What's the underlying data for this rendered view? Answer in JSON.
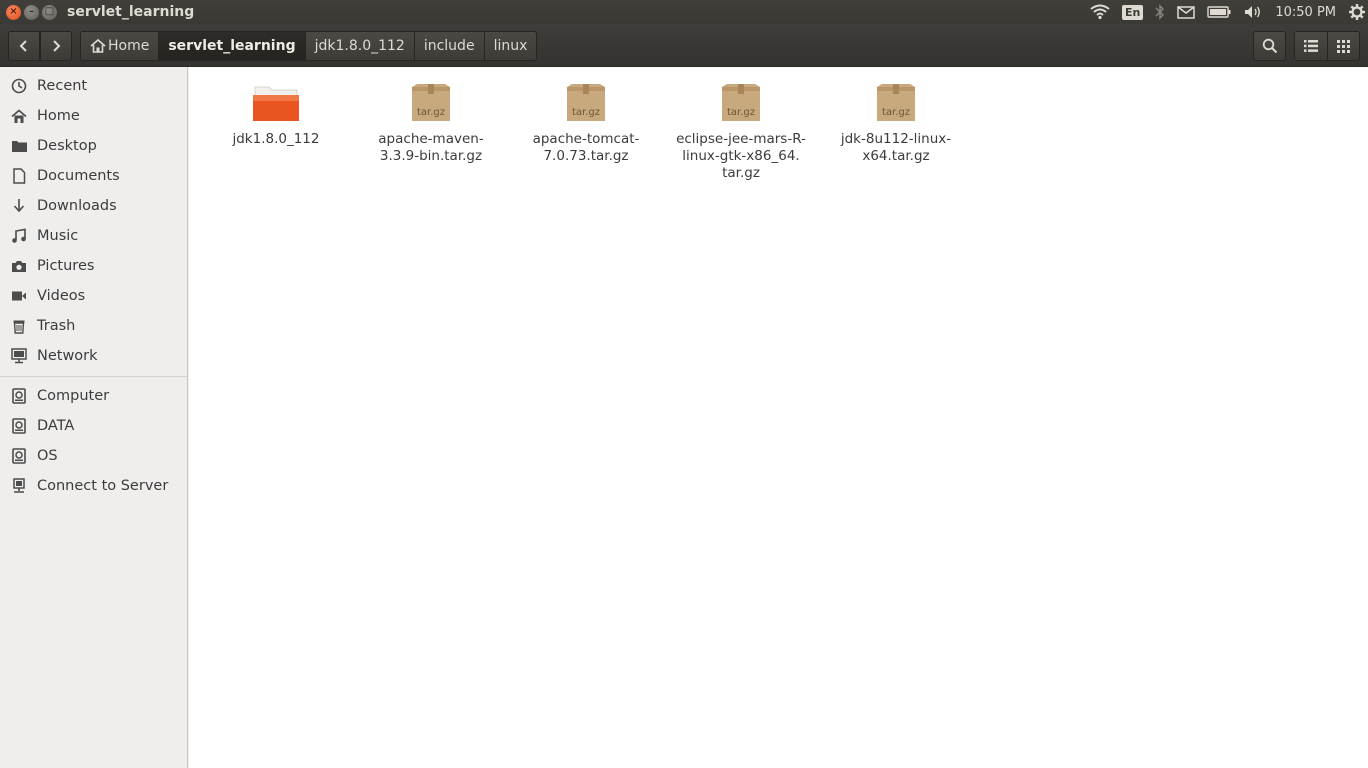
{
  "window": {
    "title": "servlet_learning",
    "buttons": {
      "close": "×",
      "minimize": "–",
      "maximize": "□"
    }
  },
  "panel": {
    "keyboard_layout": "En",
    "clock": "10:50 PM",
    "icons": [
      "wifi-icon",
      "keyboard-indicator",
      "bluetooth-icon",
      "mail-icon",
      "battery-icon",
      "volume-icon",
      "settings-gear-icon"
    ]
  },
  "toolbar": {
    "back_icon": "chevron-left-icon",
    "forward_icon": "chevron-right-icon",
    "breadcrumbs": [
      {
        "label": "Home",
        "icon": "home-icon"
      },
      {
        "label": "servlet_learning",
        "active": true
      },
      {
        "label": "jdk1.8.0_112"
      },
      {
        "label": "include"
      },
      {
        "label": "linux"
      }
    ],
    "search_icon": "search-icon",
    "view_icons": [
      "list-view-icon",
      "grid-view-icon"
    ]
  },
  "sidebar": {
    "places": [
      {
        "label": "Recent",
        "icon": "clock-icon"
      },
      {
        "label": "Home",
        "icon": "home-icon"
      },
      {
        "label": "Desktop",
        "icon": "desktop-icon"
      },
      {
        "label": "Documents",
        "icon": "document-icon"
      },
      {
        "label": "Downloads",
        "icon": "download-icon"
      },
      {
        "label": "Music",
        "icon": "music-icon"
      },
      {
        "label": "Pictures",
        "icon": "camera-icon"
      },
      {
        "label": "Videos",
        "icon": "video-icon"
      },
      {
        "label": "Trash",
        "icon": "trash-icon"
      },
      {
        "label": "Network",
        "icon": "network-icon"
      }
    ],
    "devices": [
      {
        "label": "Computer",
        "icon": "drive-icon"
      },
      {
        "label": "DATA",
        "icon": "drive-icon"
      },
      {
        "label": "OS",
        "icon": "drive-icon"
      },
      {
        "label": "Connect to Server",
        "icon": "server-icon"
      }
    ]
  },
  "files": [
    {
      "name": "jdk1.8.0_112",
      "type": "folder",
      "icon": "folder-icon"
    },
    {
      "name": "apache-maven-\n3.3.9-bin.tar.gz",
      "type": "archive",
      "icon": "archive-icon",
      "badge": "tar.gz"
    },
    {
      "name": "apache-tomcat-\n7.0.73.tar.gz",
      "type": "archive",
      "icon": "archive-icon",
      "badge": "tar.gz"
    },
    {
      "name": "eclipse-jee-mars-R-\nlinux-gtk-x86_64.\ntar.gz",
      "type": "archive",
      "icon": "archive-icon",
      "badge": "tar.gz"
    },
    {
      "name": "jdk-8u112-linux-\nx64.tar.gz",
      "type": "archive",
      "icon": "archive-icon",
      "badge": "tar.gz"
    }
  ],
  "colors": {
    "panel_bg": "#3c3b37",
    "sidebar_bg": "#efeeed",
    "folder_orange": "#e95420",
    "close_button": "#df4b16",
    "archive_tan": "#c8a97e"
  }
}
